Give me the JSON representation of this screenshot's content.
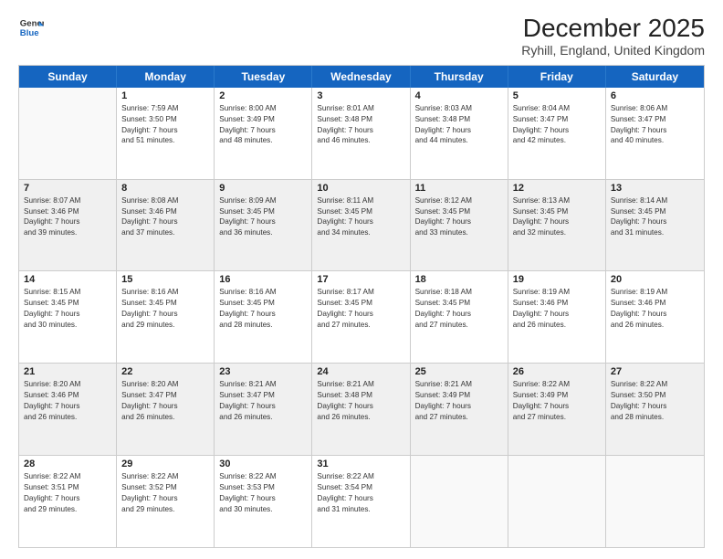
{
  "logo": {
    "line1": "General",
    "line2": "Blue"
  },
  "title": "December 2025",
  "subtitle": "Ryhill, England, United Kingdom",
  "days": [
    "Sunday",
    "Monday",
    "Tuesday",
    "Wednesday",
    "Thursday",
    "Friday",
    "Saturday"
  ],
  "rows": [
    [
      {
        "date": "",
        "lines": [],
        "empty": true
      },
      {
        "date": "1",
        "lines": [
          "Sunrise: 7:59 AM",
          "Sunset: 3:50 PM",
          "Daylight: 7 hours",
          "and 51 minutes."
        ]
      },
      {
        "date": "2",
        "lines": [
          "Sunrise: 8:00 AM",
          "Sunset: 3:49 PM",
          "Daylight: 7 hours",
          "and 48 minutes."
        ]
      },
      {
        "date": "3",
        "lines": [
          "Sunrise: 8:01 AM",
          "Sunset: 3:48 PM",
          "Daylight: 7 hours",
          "and 46 minutes."
        ]
      },
      {
        "date": "4",
        "lines": [
          "Sunrise: 8:03 AM",
          "Sunset: 3:48 PM",
          "Daylight: 7 hours",
          "and 44 minutes."
        ]
      },
      {
        "date": "5",
        "lines": [
          "Sunrise: 8:04 AM",
          "Sunset: 3:47 PM",
          "Daylight: 7 hours",
          "and 42 minutes."
        ]
      },
      {
        "date": "6",
        "lines": [
          "Sunrise: 8:06 AM",
          "Sunset: 3:47 PM",
          "Daylight: 7 hours",
          "and 40 minutes."
        ]
      }
    ],
    [
      {
        "date": "7",
        "lines": [
          "Sunrise: 8:07 AM",
          "Sunset: 3:46 PM",
          "Daylight: 7 hours",
          "and 39 minutes."
        ],
        "shaded": true
      },
      {
        "date": "8",
        "lines": [
          "Sunrise: 8:08 AM",
          "Sunset: 3:46 PM",
          "Daylight: 7 hours",
          "and 37 minutes."
        ],
        "shaded": true
      },
      {
        "date": "9",
        "lines": [
          "Sunrise: 8:09 AM",
          "Sunset: 3:45 PM",
          "Daylight: 7 hours",
          "and 36 minutes."
        ],
        "shaded": true
      },
      {
        "date": "10",
        "lines": [
          "Sunrise: 8:11 AM",
          "Sunset: 3:45 PM",
          "Daylight: 7 hours",
          "and 34 minutes."
        ],
        "shaded": true
      },
      {
        "date": "11",
        "lines": [
          "Sunrise: 8:12 AM",
          "Sunset: 3:45 PM",
          "Daylight: 7 hours",
          "and 33 minutes."
        ],
        "shaded": true
      },
      {
        "date": "12",
        "lines": [
          "Sunrise: 8:13 AM",
          "Sunset: 3:45 PM",
          "Daylight: 7 hours",
          "and 32 minutes."
        ],
        "shaded": true
      },
      {
        "date": "13",
        "lines": [
          "Sunrise: 8:14 AM",
          "Sunset: 3:45 PM",
          "Daylight: 7 hours",
          "and 31 minutes."
        ],
        "shaded": true
      }
    ],
    [
      {
        "date": "14",
        "lines": [
          "Sunrise: 8:15 AM",
          "Sunset: 3:45 PM",
          "Daylight: 7 hours",
          "and 30 minutes."
        ]
      },
      {
        "date": "15",
        "lines": [
          "Sunrise: 8:16 AM",
          "Sunset: 3:45 PM",
          "Daylight: 7 hours",
          "and 29 minutes."
        ]
      },
      {
        "date": "16",
        "lines": [
          "Sunrise: 8:16 AM",
          "Sunset: 3:45 PM",
          "Daylight: 7 hours",
          "and 28 minutes."
        ]
      },
      {
        "date": "17",
        "lines": [
          "Sunrise: 8:17 AM",
          "Sunset: 3:45 PM",
          "Daylight: 7 hours",
          "and 27 minutes."
        ]
      },
      {
        "date": "18",
        "lines": [
          "Sunrise: 8:18 AM",
          "Sunset: 3:45 PM",
          "Daylight: 7 hours",
          "and 27 minutes."
        ]
      },
      {
        "date": "19",
        "lines": [
          "Sunrise: 8:19 AM",
          "Sunset: 3:46 PM",
          "Daylight: 7 hours",
          "and 26 minutes."
        ]
      },
      {
        "date": "20",
        "lines": [
          "Sunrise: 8:19 AM",
          "Sunset: 3:46 PM",
          "Daylight: 7 hours",
          "and 26 minutes."
        ]
      }
    ],
    [
      {
        "date": "21",
        "lines": [
          "Sunrise: 8:20 AM",
          "Sunset: 3:46 PM",
          "Daylight: 7 hours",
          "and 26 minutes."
        ],
        "shaded": true
      },
      {
        "date": "22",
        "lines": [
          "Sunrise: 8:20 AM",
          "Sunset: 3:47 PM",
          "Daylight: 7 hours",
          "and 26 minutes."
        ],
        "shaded": true
      },
      {
        "date": "23",
        "lines": [
          "Sunrise: 8:21 AM",
          "Sunset: 3:47 PM",
          "Daylight: 7 hours",
          "and 26 minutes."
        ],
        "shaded": true
      },
      {
        "date": "24",
        "lines": [
          "Sunrise: 8:21 AM",
          "Sunset: 3:48 PM",
          "Daylight: 7 hours",
          "and 26 minutes."
        ],
        "shaded": true
      },
      {
        "date": "25",
        "lines": [
          "Sunrise: 8:21 AM",
          "Sunset: 3:49 PM",
          "Daylight: 7 hours",
          "and 27 minutes."
        ],
        "shaded": true
      },
      {
        "date": "26",
        "lines": [
          "Sunrise: 8:22 AM",
          "Sunset: 3:49 PM",
          "Daylight: 7 hours",
          "and 27 minutes."
        ],
        "shaded": true
      },
      {
        "date": "27",
        "lines": [
          "Sunrise: 8:22 AM",
          "Sunset: 3:50 PM",
          "Daylight: 7 hours",
          "and 28 minutes."
        ],
        "shaded": true
      }
    ],
    [
      {
        "date": "28",
        "lines": [
          "Sunrise: 8:22 AM",
          "Sunset: 3:51 PM",
          "Daylight: 7 hours",
          "and 29 minutes."
        ]
      },
      {
        "date": "29",
        "lines": [
          "Sunrise: 8:22 AM",
          "Sunset: 3:52 PM",
          "Daylight: 7 hours",
          "and 29 minutes."
        ]
      },
      {
        "date": "30",
        "lines": [
          "Sunrise: 8:22 AM",
          "Sunset: 3:53 PM",
          "Daylight: 7 hours",
          "and 30 minutes."
        ]
      },
      {
        "date": "31",
        "lines": [
          "Sunrise: 8:22 AM",
          "Sunset: 3:54 PM",
          "Daylight: 7 hours",
          "and 31 minutes."
        ]
      },
      {
        "date": "",
        "lines": [],
        "empty": true
      },
      {
        "date": "",
        "lines": [],
        "empty": true
      },
      {
        "date": "",
        "lines": [],
        "empty": true
      }
    ]
  ]
}
